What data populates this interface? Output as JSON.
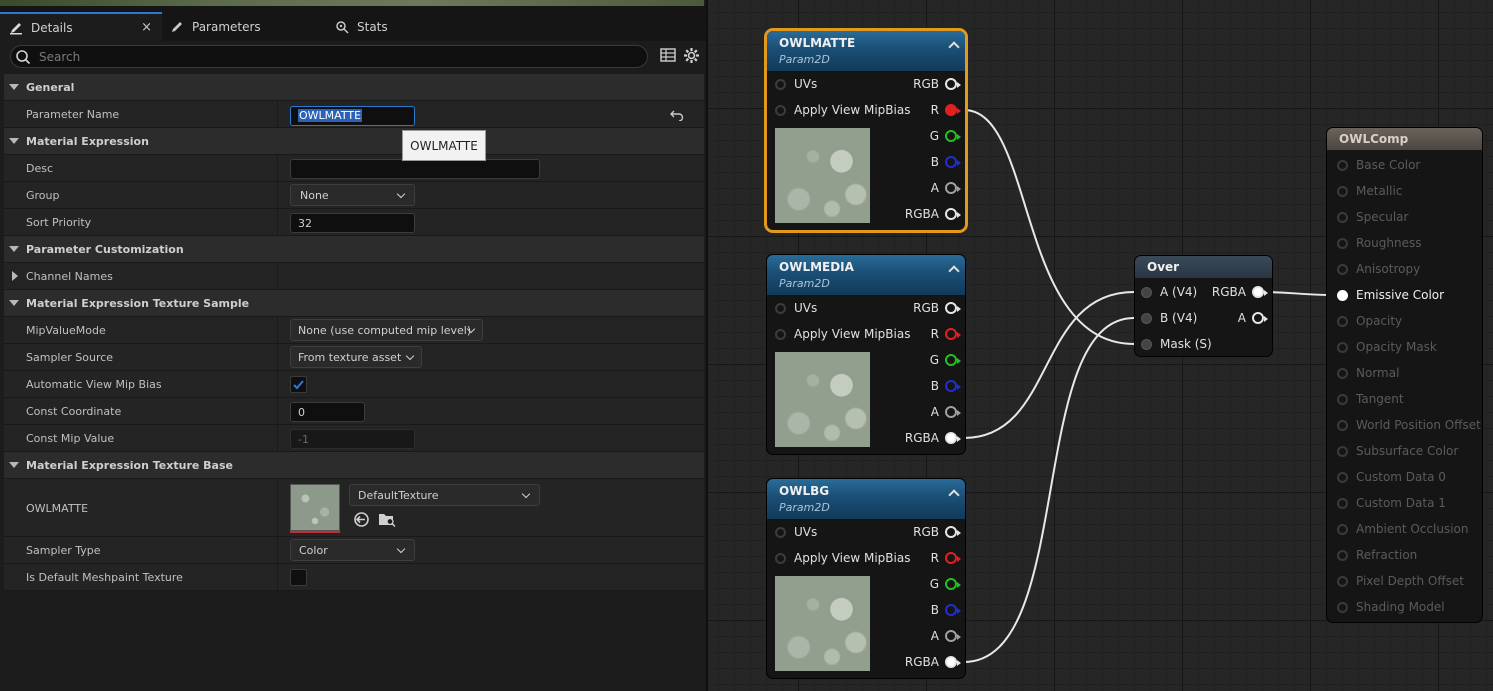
{
  "tabs": [
    {
      "label": "Details",
      "close": "×"
    },
    {
      "label": "Parameters"
    },
    {
      "label": "Stats"
    }
  ],
  "search": {
    "placeholder": "Search"
  },
  "details": {
    "general_label": "General",
    "param_name_label": "Parameter Name",
    "param_name_value": "OWLMATTE",
    "tooltip": "OWLMATTE",
    "material_expression_label": "Material Expression",
    "desc_label": "Desc",
    "desc_value": "",
    "group_label": "Group",
    "group_value": "None",
    "sort_priority_label": "Sort Priority",
    "sort_priority_value": "32",
    "param_customization_label": "Parameter Customization",
    "channel_names_label": "Channel Names",
    "tex_sample_label": "Material Expression Texture Sample",
    "mip_value_mode_label": "MipValueMode",
    "mip_value_mode_value": "None (use computed mip level)",
    "sampler_source_label": "Sampler Source",
    "sampler_source_value": "From texture asset",
    "auto_view_mip_label": "Automatic View Mip Bias",
    "auto_view_mip_checked": true,
    "const_coord_label": "Const Coordinate",
    "const_coord_value": "0",
    "const_mip_label": "Const Mip Value",
    "const_mip_value": "-1",
    "tex_base_label": "Material Expression Texture Base",
    "texture_label": "OWLMATTE",
    "texture_asset": "DefaultTexture",
    "sampler_type_label": "Sampler Type",
    "sampler_type_value": "Color",
    "default_meshpaint_label": "Is Default Meshpaint Texture",
    "default_meshpaint_checked": false
  },
  "graph": {
    "param_nodes": [
      {
        "title": "OWLMATTE",
        "subtitle": "Param2D",
        "selected": true
      },
      {
        "title": "OWLMEDIA",
        "subtitle": "Param2D",
        "selected": false
      },
      {
        "title": "OWLBG",
        "subtitle": "Param2D",
        "selected": false
      }
    ],
    "pins_in": [
      "UVs",
      "Apply View MipBias"
    ],
    "pins_out": [
      "RGB",
      "R",
      "G",
      "B",
      "A",
      "RGBA"
    ],
    "over_node": {
      "title": "Over",
      "inputs": [
        "A (V4)",
        "B (V4)",
        "Mask (S)"
      ],
      "outputs": [
        "RGBA",
        "A"
      ]
    },
    "comp_node": {
      "title": "OWLComp",
      "inputs": [
        "Base Color",
        "Metallic",
        "Specular",
        "Roughness",
        "Anisotropy",
        "Emissive Color",
        "Opacity",
        "Opacity Mask",
        "Normal",
        "Tangent",
        "World Position Offset",
        "Subsurface Color",
        "Custom Data 0",
        "Custom Data 1",
        "Ambient Occlusion",
        "Refraction",
        "Pixel Depth Offset",
        "Shading Model"
      ],
      "active_input": "Emissive Color"
    },
    "colors": {
      "selection": "#e39a1c",
      "accent": "#2b79d0",
      "pin_r": "#e02020",
      "pin_g": "#20c020",
      "pin_b": "#2030d0"
    }
  }
}
